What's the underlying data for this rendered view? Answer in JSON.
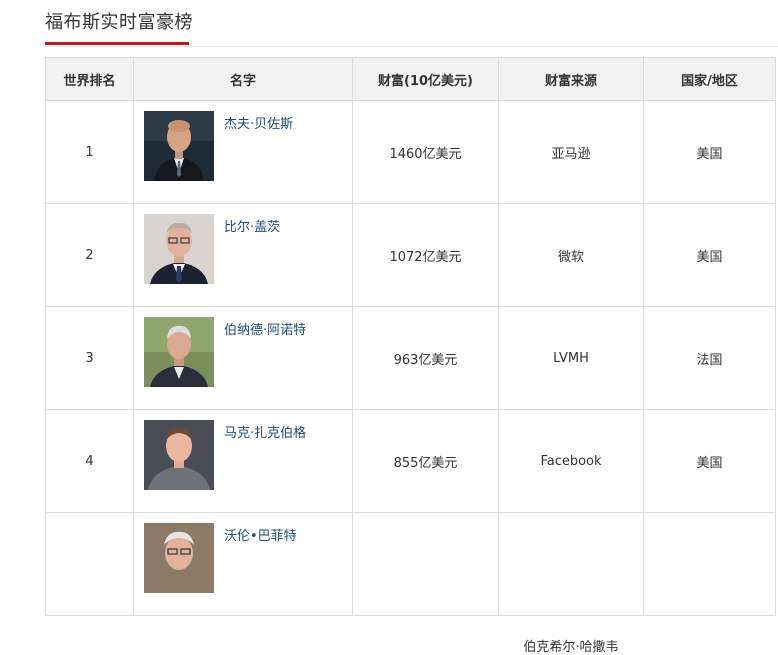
{
  "header": {
    "title": "福布斯实时富豪榜"
  },
  "table": {
    "columns": [
      "世界排名",
      "名字",
      "财富(10亿美元)",
      "财富来源",
      "国家/地区"
    ],
    "rows": [
      {
        "rank": "1",
        "name": "杰夫·贝佐斯",
        "wealth": "1460亿美元",
        "source": "亚马逊",
        "country": "美国"
      },
      {
        "rank": "2",
        "name": "比尔·盖茨",
        "wealth": "1072亿美元",
        "source": "微软",
        "country": "美国"
      },
      {
        "rank": "3",
        "name": "伯纳德·阿诺特",
        "wealth": "963亿美元",
        "source": "LVMH",
        "country": "法国"
      },
      {
        "rank": "4",
        "name": "马克·扎克伯格",
        "wealth": "855亿美元",
        "source": "Facebook",
        "country": "美国"
      },
      {
        "rank": "",
        "name": "沃伦•巴菲特",
        "wealth": "",
        "source": "伯克希尔·哈撒韦",
        "country": ""
      }
    ]
  }
}
